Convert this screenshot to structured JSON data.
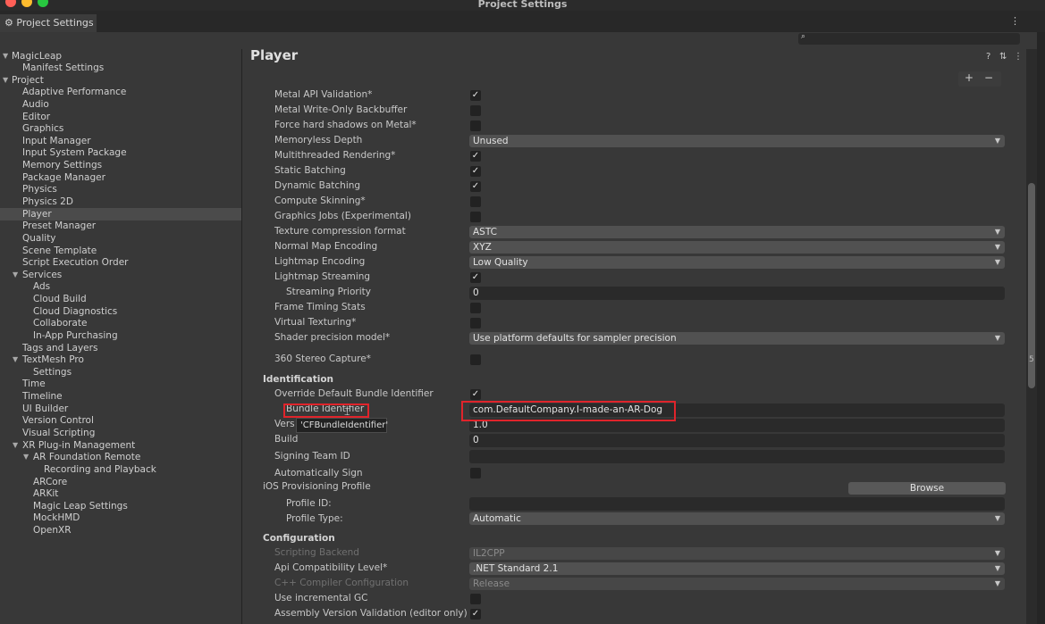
{
  "window": {
    "title": "Project Settings"
  },
  "tab": {
    "label": "Project Settings"
  },
  "sidebar": {
    "items": [
      {
        "label": "MagicLeap"
      },
      {
        "label": "Manifest Settings"
      },
      {
        "label": "Project"
      },
      {
        "label": "Adaptive Performance"
      },
      {
        "label": "Audio"
      },
      {
        "label": "Editor"
      },
      {
        "label": "Graphics"
      },
      {
        "label": "Input Manager"
      },
      {
        "label": "Input System Package"
      },
      {
        "label": "Memory Settings"
      },
      {
        "label": "Package Manager"
      },
      {
        "label": "Physics"
      },
      {
        "label": "Physics 2D"
      },
      {
        "label": "Player"
      },
      {
        "label": "Preset Manager"
      },
      {
        "label": "Quality"
      },
      {
        "label": "Scene Template"
      },
      {
        "label": "Script Execution Order"
      },
      {
        "label": "Services"
      },
      {
        "label": "Ads"
      },
      {
        "label": "Cloud Build"
      },
      {
        "label": "Cloud Diagnostics"
      },
      {
        "label": "Collaborate"
      },
      {
        "label": "In-App Purchasing"
      },
      {
        "label": "Tags and Layers"
      },
      {
        "label": "TextMesh Pro"
      },
      {
        "label": "Settings"
      },
      {
        "label": "Time"
      },
      {
        "label": "Timeline"
      },
      {
        "label": "UI Builder"
      },
      {
        "label": "Version Control"
      },
      {
        "label": "Visual Scripting"
      },
      {
        "label": "XR Plug-in Management"
      },
      {
        "label": "AR Foundation Remote"
      },
      {
        "label": "Recording and Playback"
      },
      {
        "label": "ARCore"
      },
      {
        "label": "ARKit"
      },
      {
        "label": "Magic Leap Settings"
      },
      {
        "label": "MockHMD"
      },
      {
        "label": "OpenXR"
      }
    ]
  },
  "main": {
    "title": "Player",
    "rows": {
      "metal_api_validation": {
        "label": "Metal API Validation*"
      },
      "metal_write_only": {
        "label": "Metal Write-Only Backbuffer"
      },
      "force_hard_shadows": {
        "label": "Force hard shadows on Metal*"
      },
      "memoryless_depth": {
        "label": "Memoryless Depth",
        "value": "Unused"
      },
      "multithreaded": {
        "label": "Multithreaded Rendering*"
      },
      "static_batching": {
        "label": "Static Batching"
      },
      "dynamic_batching": {
        "label": "Dynamic Batching"
      },
      "compute_skinning": {
        "label": "Compute Skinning*"
      },
      "graphics_jobs": {
        "label": "Graphics Jobs (Experimental)"
      },
      "texture_compression": {
        "label": "Texture compression format",
        "value": "ASTC"
      },
      "normal_map": {
        "label": "Normal Map Encoding",
        "value": "XYZ"
      },
      "lightmap_encoding": {
        "label": "Lightmap Encoding",
        "value": "Low Quality"
      },
      "lightmap_streaming": {
        "label": "Lightmap Streaming"
      },
      "streaming_priority": {
        "label": "Streaming Priority",
        "value": "0"
      },
      "frame_timing": {
        "label": "Frame Timing Stats"
      },
      "virtual_texturing": {
        "label": "Virtual Texturing*"
      },
      "shader_precision": {
        "label": "Shader precision model*",
        "value": "Use platform defaults for sampler precision"
      },
      "stereo_capture": {
        "label": "360 Stereo Capture*"
      },
      "identification": {
        "label": "Identification"
      },
      "override_bundle": {
        "label": "Override Default Bundle Identifier"
      },
      "bundle_identifier": {
        "label": "Bundle Identifier",
        "value": "com.DefaultCompany.I-made-an-AR-Dog"
      },
      "tooltip": {
        "text": "'CFBundleIdentifier'"
      },
      "version": {
        "label": "Vers",
        "value": "1.0"
      },
      "build": {
        "label": "Build",
        "value": "0"
      },
      "signing_team": {
        "label": "Signing Team ID",
        "value": ""
      },
      "auto_sign": {
        "label": "Automatically Sign"
      },
      "ios_provisioning": {
        "label": "iOS Provisioning Profile",
        "button": "Browse"
      },
      "profile_id": {
        "label": "Profile ID:",
        "value": ""
      },
      "profile_type": {
        "label": "Profile Type:",
        "value": "Automatic"
      },
      "configuration": {
        "label": "Configuration"
      },
      "scripting_backend": {
        "label": "Scripting Backend",
        "value": "IL2CPP"
      },
      "api_compat": {
        "label": "Api Compatibility Level*",
        "value": ".NET Standard 2.1"
      },
      "cpp_compiler": {
        "label": "C++ Compiler Configuration",
        "value": "Release"
      },
      "incremental_gc": {
        "label": "Use incremental GC"
      },
      "assembly_validation": {
        "label": "Assembly Version Validation (editor only)"
      }
    }
  },
  "icons": {
    "check": "✓",
    "dropdown": "▼",
    "collapse": "▼",
    "gear": "⚙",
    "help": "?",
    "presets": "⇅",
    "menu": "⋮",
    "plus": "+",
    "minus": "−",
    "search": "🔍"
  },
  "colors": {
    "highlight": "#e0242b",
    "selected": "#4b4b4b"
  },
  "edge_text": "5"
}
